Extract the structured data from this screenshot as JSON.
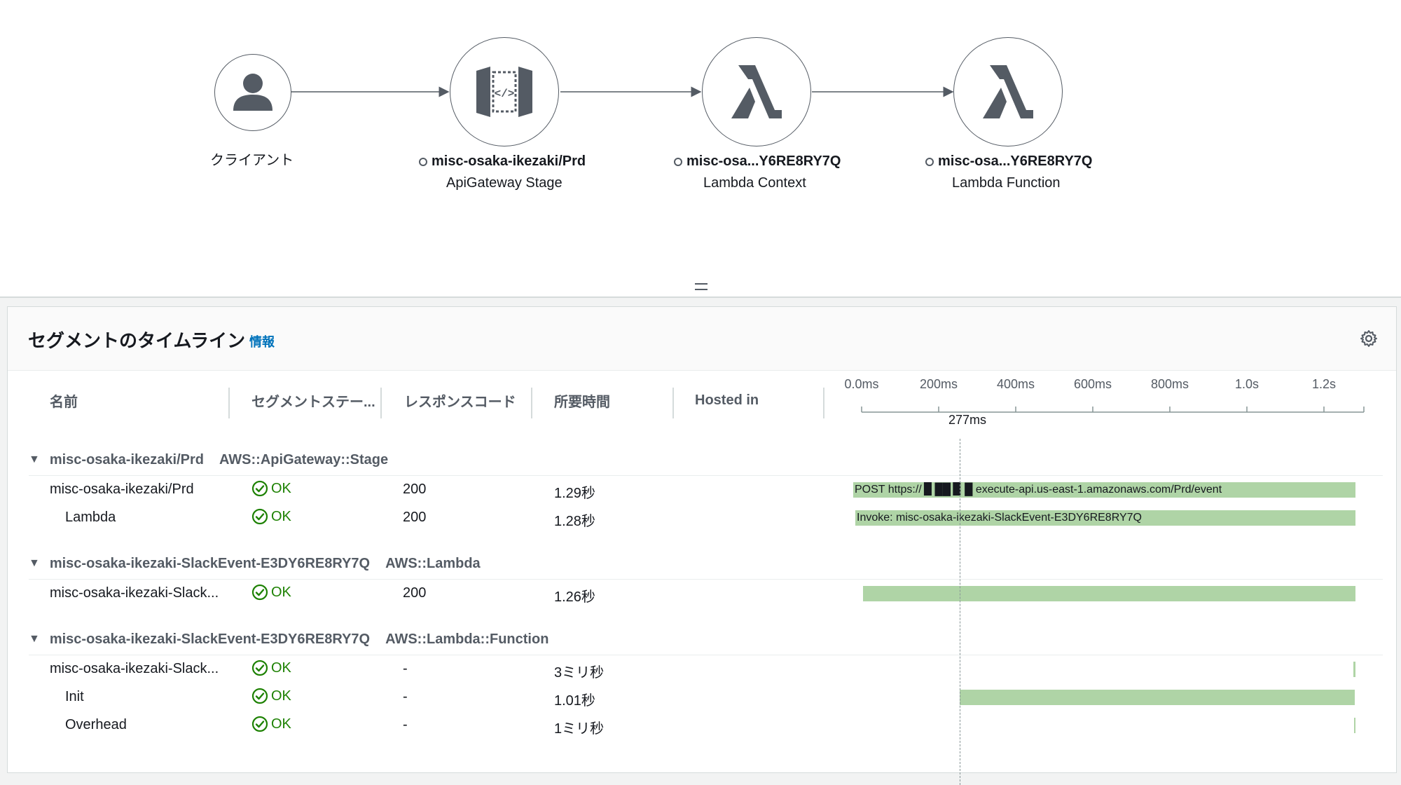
{
  "service_map": {
    "client_label": "クライアント",
    "nodes": [
      {
        "name": "misc-osaka-ikezaki/Prd",
        "type": "ApiGateway Stage",
        "icon": "api-gateway-icon"
      },
      {
        "name": "misc-osa...Y6RE8RY7Q",
        "type": "Lambda Context",
        "icon": "lambda-icon"
      },
      {
        "name": "misc-osa...Y6RE8RY7Q",
        "type": "Lambda Function",
        "icon": "lambda-icon"
      }
    ],
    "colors": {
      "icon": "#545b64",
      "edge": "#545b64"
    }
  },
  "timeline": {
    "title": "セグメントのタイムライン",
    "info_link": "情報",
    "columns": {
      "name": "名前",
      "segment_status": "セグメントステー...",
      "response_code": "レスポンスコード",
      "duration": "所要時間",
      "hosted_in": "Hosted in"
    },
    "axis": {
      "ticks": [
        "0.0ms",
        "200ms",
        "400ms",
        "600ms",
        "800ms",
        "1.0s",
        "1.2s"
      ],
      "cursor_label": "277ms"
    },
    "groups": [
      {
        "name": "misc-osaka-ikezaki/Prd",
        "type": "AWS::ApiGateway::Stage",
        "rows": [
          {
            "name": "misc-osaka-ikezaki/Prd",
            "status": "OK",
            "code": "200",
            "duration": "1.29秒",
            "bar_label": "POST https:// ▉ ██ ▉ █ execute-api.us-east-1.amazonaws.com/Prd/event"
          },
          {
            "name": "Lambda",
            "status": "OK",
            "code": "200",
            "duration": "1.28秒",
            "bar_label": "Invoke: misc-osaka-ikezaki-SlackEvent-E3DY6RE8RY7Q"
          }
        ]
      },
      {
        "name": "misc-osaka-ikezaki-SlackEvent-E3DY6RE8RY7Q",
        "type": "AWS::Lambda",
        "rows": [
          {
            "name": "misc-osaka-ikezaki-Slack...",
            "status": "OK",
            "code": "200",
            "duration": "1.26秒",
            "bar_label": ""
          }
        ]
      },
      {
        "name": "misc-osaka-ikezaki-SlackEvent-E3DY6RE8RY7Q",
        "type": "AWS::Lambda::Function",
        "rows": [
          {
            "name": "misc-osaka-ikezaki-Slack...",
            "status": "OK",
            "code": "-",
            "duration": "3ミリ秒",
            "bar_label": ""
          },
          {
            "name": "Init",
            "status": "OK",
            "code": "-",
            "duration": "1.01秒",
            "bar_label": ""
          },
          {
            "name": "Overhead",
            "status": "OK",
            "code": "-",
            "duration": "1ミリ秒",
            "bar_label": ""
          }
        ]
      }
    ],
    "colors": {
      "bar": "#afd4a6",
      "ok": "#1d8102",
      "link": "#0073bb"
    }
  }
}
